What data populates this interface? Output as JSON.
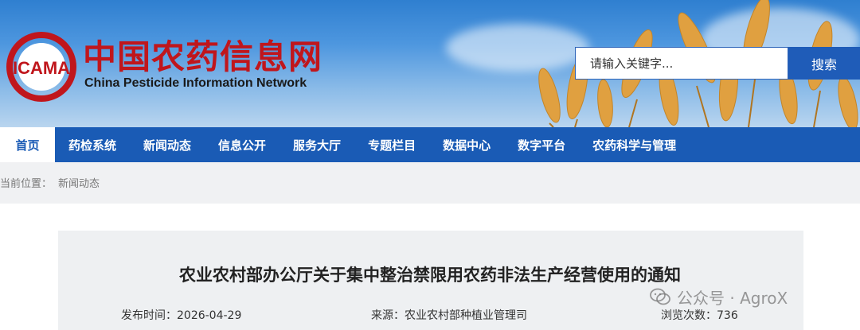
{
  "header": {
    "logo_text": "ICAMA",
    "title_cn": "中国农药信息网",
    "title_en": "China Pesticide Information Network"
  },
  "search": {
    "placeholder": "请输入关键字...",
    "button_label": "搜索"
  },
  "nav": {
    "items": [
      {
        "label": "首页",
        "active": true
      },
      {
        "label": "药检系统"
      },
      {
        "label": "新闻动态"
      },
      {
        "label": "信息公开"
      },
      {
        "label": "服务大厅"
      },
      {
        "label": "专题栏目"
      },
      {
        "label": "数据中心"
      },
      {
        "label": "数字平台"
      },
      {
        "label": "农药科学与管理"
      }
    ]
  },
  "breadcrumb": {
    "prefix": "当前位置：",
    "current": "新闻动态"
  },
  "article": {
    "title": "农业农村部办公厅关于集中整治禁限用农药非法生产经营使用的通知",
    "publish_label": "发布时间：",
    "publish_date": "2026-04-29",
    "source_label": "来源：",
    "source": "农业农村部种植业管理司",
    "views_label": "浏览次数：",
    "views": "736"
  },
  "watermark": {
    "text": "公众号 · AgroX"
  },
  "colors": {
    "brand_red": "#c0161c",
    "nav_blue": "#1a5bb5",
    "search_button": "#1f5cb8"
  }
}
